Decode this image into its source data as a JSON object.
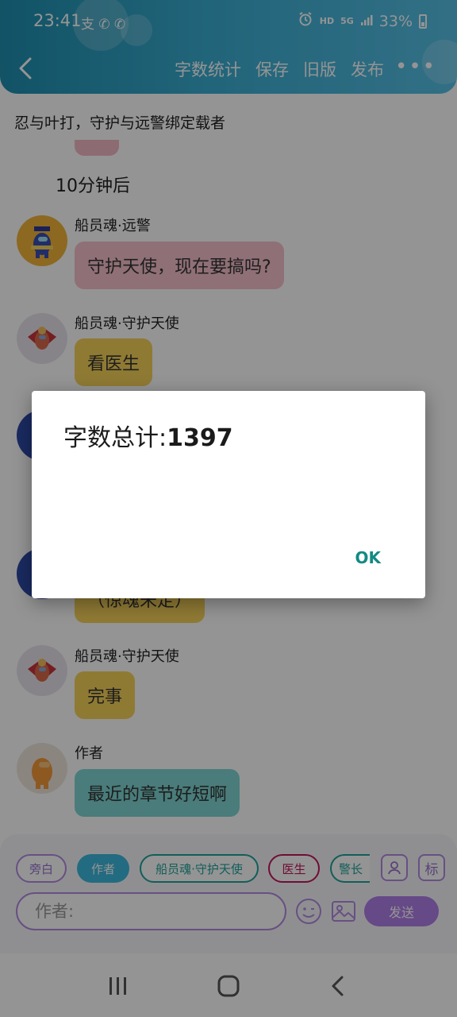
{
  "status_bar": {
    "time": "23:41",
    "left_icons": "支 ✆ ✆",
    "hd": "HD",
    "network": "5G",
    "battery": "33%"
  },
  "header": {
    "actions": [
      "字数统计",
      "保存",
      "旧版",
      "发布"
    ],
    "more": "•••"
  },
  "subtitle": "忍与叶打，守护与远警绑定载者",
  "time_note": "10分钟后",
  "messages": [
    {
      "speaker": "船员魂·远警",
      "text": "守护天使，现在要搞吗?",
      "color": "pink"
    },
    {
      "speaker": "船员魂·守护天使",
      "text": "看医生",
      "color": "yellow"
    },
    {
      "speaker": "",
      "text": "（惊魂未定）",
      "color": "yellow"
    },
    {
      "speaker": "船员魂·守护天使",
      "text": "完事",
      "color": "yellow"
    },
    {
      "speaker": "作者",
      "text": "最近的章节好短啊",
      "color": "teal"
    }
  ],
  "chips": [
    "旁白",
    "作者",
    "船员魂·守护天使",
    "医生",
    "警长"
  ],
  "side_button": "标",
  "input": {
    "placeholder": "作者:"
  },
  "send_label": "发送",
  "dialog": {
    "label": "字数总计:",
    "count": "1397",
    "ok_label": "OK"
  },
  "colors": {
    "header": "#3aaed2",
    "pink_bubble": "#f7c1cc",
    "yellow_bubble": "#f7d25a",
    "teal_bubble": "#7fd6d3",
    "accent_purple": "#b07ee8",
    "ok_button": "#138a84"
  }
}
